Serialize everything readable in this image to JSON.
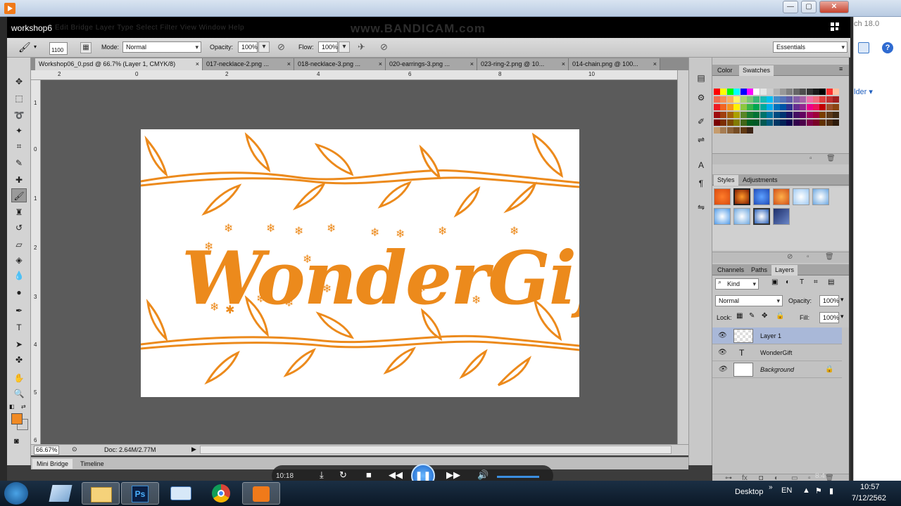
{
  "window": {
    "title": "workshop6",
    "menu": "Edit   Bridge   Layer   Type   Select   Filter   View   Window   Help",
    "watermark": "www.BANDICAM.com"
  },
  "browser_sliver": {
    "version_text": "ch 18.0",
    "folder_text": "lder ▾"
  },
  "options_bar": {
    "brush_size": "1100",
    "mode_label": "Mode:",
    "mode_value": "Normal",
    "opacity_label": "Opacity:",
    "opacity_value": "100%",
    "flow_label": "Flow:",
    "flow_value": "100%",
    "workspace": "Essentials"
  },
  "doc_tabs": [
    {
      "label": "Workshop06_0.psd @ 66.7% (Layer 1, CMYK/8)",
      "close": "×"
    },
    {
      "label": "017-necklace-2.png ...",
      "close": "×"
    },
    {
      "label": "018-necklace-3.png ...",
      "close": "×"
    },
    {
      "label": "020-earrings-3.png ...",
      "close": "×"
    },
    {
      "label": "023-ring-2.png @ 10...",
      "close": "×"
    },
    {
      "label": "014-chain.png @ 100...",
      "close": "×"
    }
  ],
  "ruler": {
    "top": [
      "2",
      "0",
      "2",
      "4",
      "6",
      "8",
      "10"
    ],
    "left": [
      "1",
      "0",
      "1",
      "2",
      "3",
      "4",
      "5",
      "6"
    ]
  },
  "status": {
    "zoom": "66.67%",
    "doc": "Doc: 2.64M/2.77M"
  },
  "bottom_tabs": [
    "Mini Bridge",
    "Timeline"
  ],
  "canvas": {
    "artwork_text": "WonderGift",
    "art_color": "#ec8a1c"
  },
  "panels": {
    "color_tabs": [
      "Color",
      "Swatches"
    ],
    "styles_tabs": [
      "Styles",
      "Adjustments"
    ],
    "layers_tabs": [
      "Channels",
      "Paths",
      "Layers"
    ],
    "kind_label": "Kind",
    "blend_mode": "Normal",
    "opacity_label": "Opacity:",
    "opacity_value": "100%",
    "lock_label": "Lock:",
    "fill_label": "Fill:",
    "fill_value": "100%",
    "layers": [
      {
        "name": "Layer 1",
        "type": "pixel"
      },
      {
        "name": "WonderGift",
        "type": "text",
        "icon": "T"
      },
      {
        "name": "Background",
        "type": "background"
      }
    ]
  },
  "player": {
    "time": "10:18"
  },
  "taskbar": {
    "desktop": "Desktop",
    "lang": "EN",
    "clock_time": "10:57",
    "clock_date": "7/12/2562",
    "overlay_time": "8:4"
  },
  "colors": {
    "foreground": "#f08a24",
    "background": "#ffffff"
  }
}
